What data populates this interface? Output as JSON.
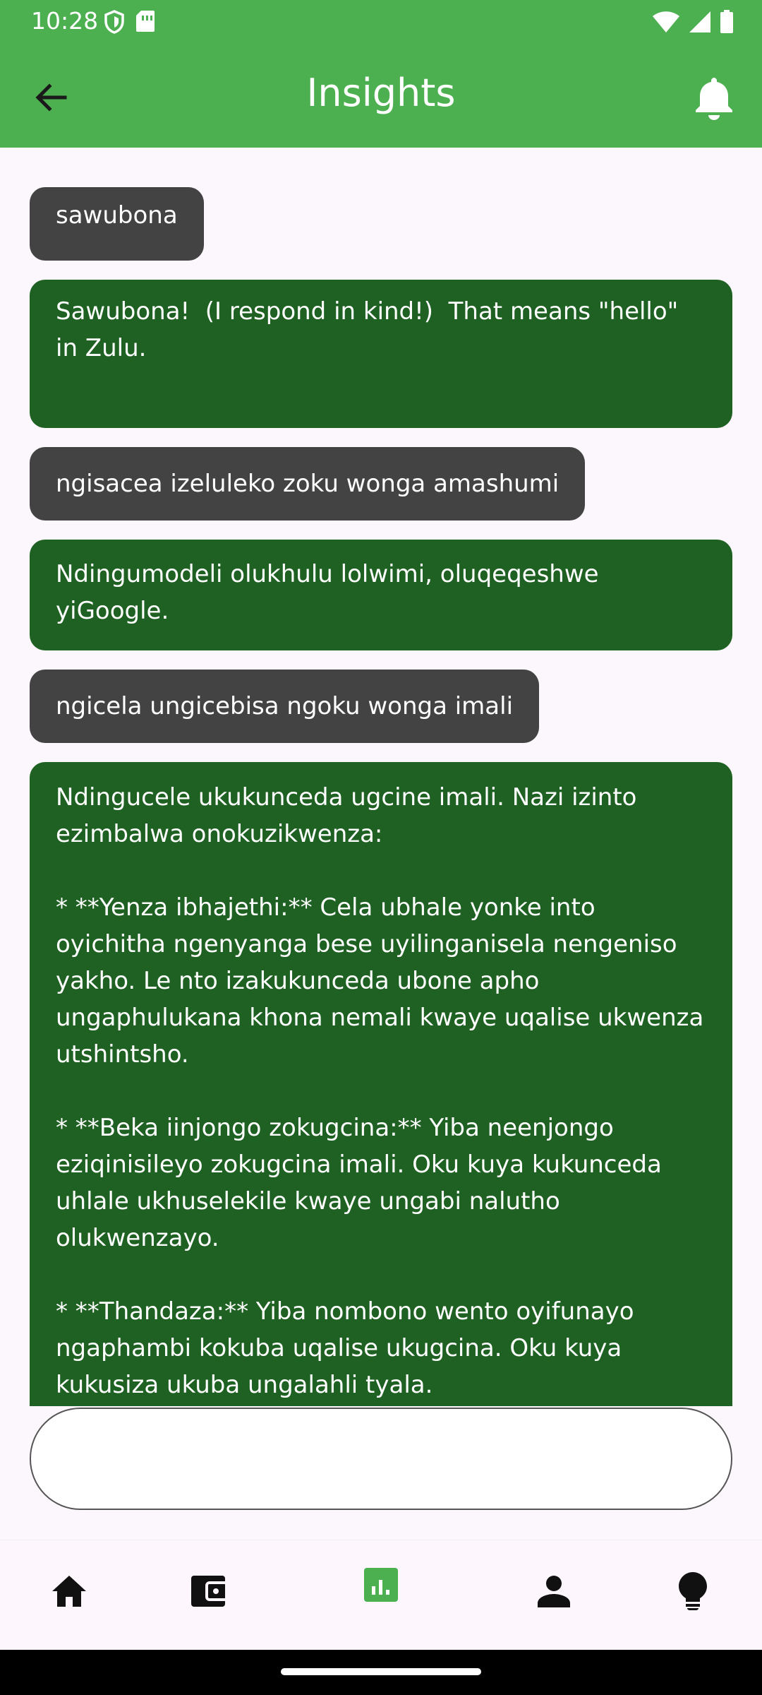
{
  "status_bar": {
    "time": "10:28",
    "icons": [
      "shield-icon",
      "sim-card-icon",
      "wifi-icon",
      "signal-icon",
      "battery-icon"
    ]
  },
  "app_bar": {
    "title": "Insights",
    "back_icon": "arrow-back-icon",
    "action_icon": "bell-icon",
    "color": "#4caf50"
  },
  "messages": [
    {
      "role": "user",
      "text": "sawubona"
    },
    {
      "role": "bot",
      "text": "Sawubona!  (I respond in kind!)  That means \"hello\" in Zulu.\n"
    },
    {
      "role": "user",
      "text": "ngisacea izeluleko zoku wonga amashumi"
    },
    {
      "role": "bot",
      "text": "Ndingumodeli olukhulu lolwimi, oluqeqeshwe yiGoogle."
    },
    {
      "role": "user",
      "text": "ngicela ungicebisa ngoku wonga imali"
    },
    {
      "role": "bot",
      "text": "Ndingucele ukukunceda ugcine imali. Nazi izinto ezimbalwa onokuzikwenza:\n\n* **Yenza ibhajethi:** Cela ubhale yonke into oyichitha ngenyanga bese uyilinganisela nengeniso yakho. Le nto izakukunceda ubone apho ungaphulukana khona nemali kwaye uqalise ukwenza utshintsho.\n\n* **Beka iinjongo zokugcina:** Yiba neenjongo eziqinisileyo zokugcina imali. Oku kuya kukunceda uhlale ukhuselekile kwaye ungabi nalutho olukwenzayo.\n\n* **Thandaza:** Yiba nombono wento oyifunayo ngaphambi kokuba uqalise ukugcina. Oku kuya kukusiza ukuba ungalahli tyala."
    }
  ],
  "composer": {
    "value": "",
    "placeholder": ""
  },
  "bottom_nav": {
    "items": [
      {
        "icon": "home-icon",
        "selected": false
      },
      {
        "icon": "wallet-icon",
        "selected": false
      },
      {
        "icon": "bar-chart-icon",
        "selected": true
      },
      {
        "icon": "person-icon",
        "selected": false
      },
      {
        "icon": "lightbulb-icon",
        "selected": false
      }
    ],
    "selected_color": "#4caf50"
  }
}
